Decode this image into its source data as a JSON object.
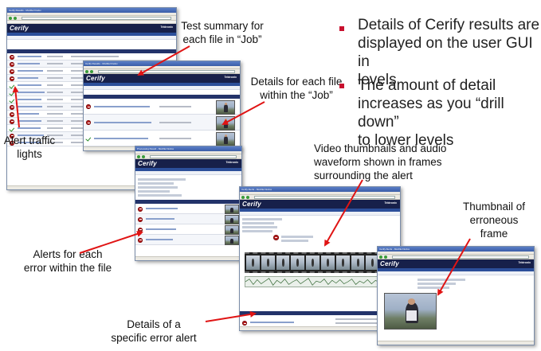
{
  "screens": {
    "job_summary": {
      "title_bar": "Cerify Results - Mozilla Firefox",
      "logo": "Cerify",
      "brand": "Tektronix"
    },
    "file_details": {
      "title_bar": "Cerify Results - Mozilla Firefox",
      "logo": "Cerify",
      "brand": "Tektronix"
    },
    "error_alerts": {
      "title_bar": "Processing Result - Mozilla Firefox",
      "logo": "Cerify",
      "brand": "Tektronix"
    },
    "alert_frames": {
      "title_bar": "Cerify Alerts - Mozilla Firefox",
      "logo": "Cerify",
      "brand": "Tektronix"
    },
    "erroneous_frame": {
      "title_bar": "Cerify Alerts - Mozilla Firefox",
      "logo": "Cerify",
      "brand": "Tektronix"
    }
  },
  "annotations": {
    "test_summary": "Test summary for\neach file in “Job”",
    "file_details": "Details for each file\nwithin the “Job”",
    "alert_lights": "Alert traffic\nlights",
    "video_thumbs": "Video thumbnails and audio\nwaveform shown in frames\nsurrounding the alert",
    "thumbnail_frame": "Thumbnail of\nerroneous\nframe",
    "alerts_each_error": "Alerts for each\nerror within the file",
    "specific_alert": "Details of a\nspecific error alert"
  },
  "bullets": [
    "Details of Cerify results are\ndisplayed on the user GUI in\nlevels",
    "The amount of detail\nincreases as you “drill down”\nto lower levels"
  ],
  "colors": {
    "bullet_square": "#c8102e",
    "arrow": "#e01414",
    "cerify_header": "#17204a",
    "alert_red": "#b81f1f",
    "ok_green": "#2a8c2a"
  }
}
